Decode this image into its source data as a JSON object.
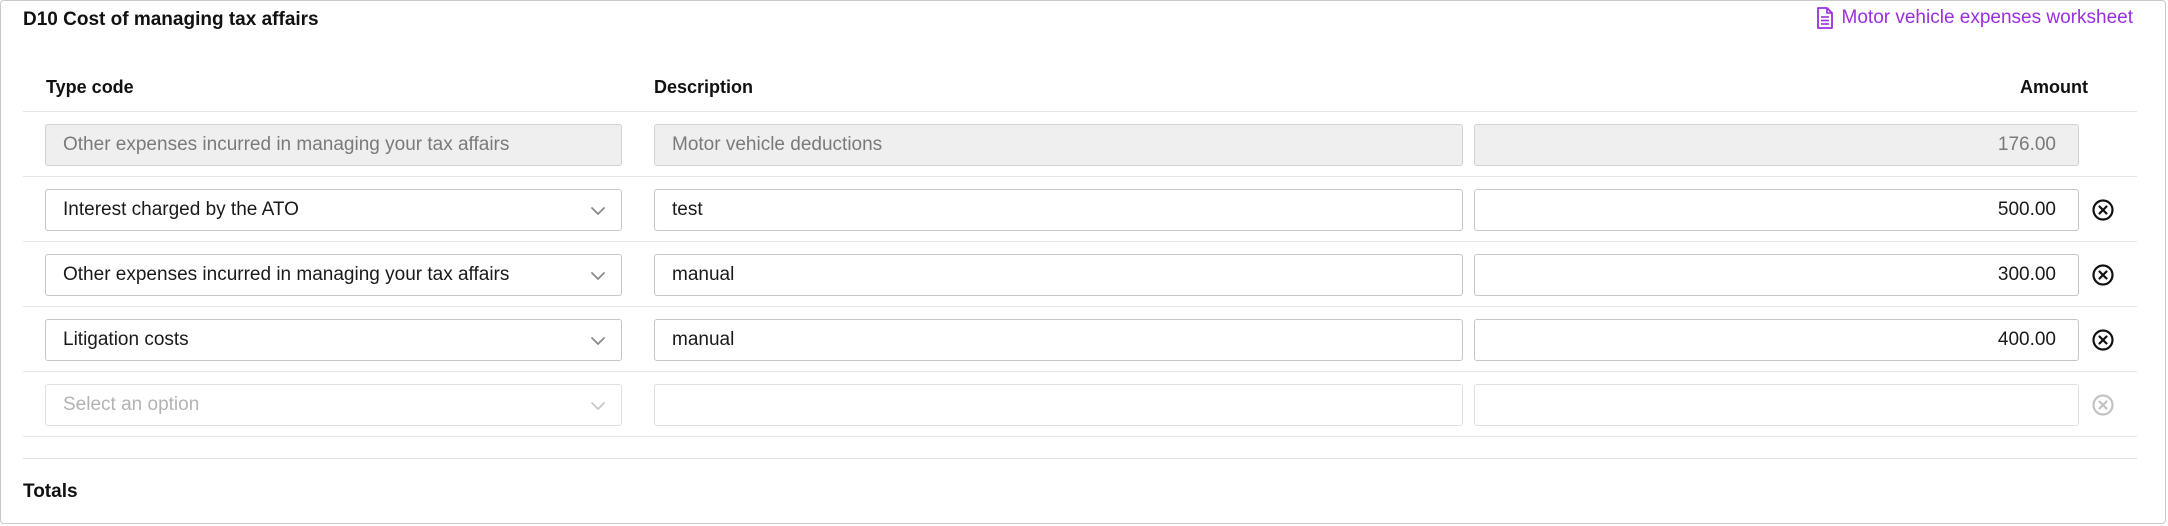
{
  "section": {
    "title": "D10 Cost of managing tax affairs",
    "worksheet_link": "Motor vehicle expenses worksheet"
  },
  "table": {
    "headers": {
      "type": "Type code",
      "description": "Description",
      "amount": "Amount"
    },
    "rows": [
      {
        "type": "Other expenses incurred in managing your tax affairs",
        "description": "Motor vehicle deductions",
        "amount": "176.00",
        "state": "readonly"
      },
      {
        "type": "Interest charged by the ATO",
        "description": "test",
        "amount": "500.00",
        "state": "editable"
      },
      {
        "type": "Other expenses incurred in managing your tax affairs",
        "description": "manual",
        "amount": "300.00",
        "state": "editable"
      },
      {
        "type": "Litigation costs",
        "description": "manual",
        "amount": "400.00",
        "state": "editable"
      },
      {
        "type_placeholder": "Select an option",
        "description": "",
        "amount": "",
        "state": "empty"
      }
    ]
  },
  "totals": {
    "label": "Totals"
  },
  "colors": {
    "link": "#9b2ee0",
    "disabled_bg": "#efefef",
    "border": "#c6c6c6"
  },
  "icons": {
    "worksheet": "document-icon",
    "dropdown": "chevron-down-icon",
    "remove": "close-circle-icon"
  }
}
